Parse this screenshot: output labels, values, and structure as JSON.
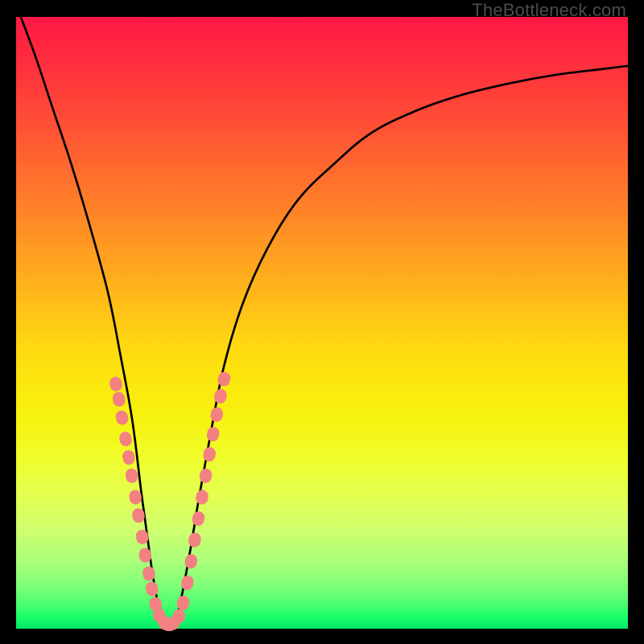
{
  "watermark": "TheBottleneck.com",
  "chart_data": {
    "type": "line",
    "title": "",
    "xlabel": "",
    "ylabel": "",
    "xlim": [
      0,
      100
    ],
    "ylim": [
      0,
      100
    ],
    "series": [
      {
        "name": "bottleneck-curve",
        "x": [
          0,
          3,
          6,
          9,
          12,
          15,
          17,
          19,
          20.5,
          22,
          23,
          24,
          25,
          26,
          27,
          28.5,
          30,
          32,
          34,
          37,
          41,
          46,
          52,
          58,
          65,
          72,
          80,
          88,
          96,
          100
        ],
        "values": [
          102,
          94,
          85,
          76,
          66,
          55,
          45,
          34,
          22,
          11,
          5,
          1,
          0,
          1,
          5,
          13,
          22,
          33,
          43,
          53,
          62,
          70,
          76,
          81,
          84.5,
          87,
          89,
          90.5,
          91.5,
          92
        ]
      }
    ],
    "highlight_beads": {
      "comment": "salmon bead overlays near valley, in plot-percent coords",
      "left_arm": [
        [
          16.3,
          40
        ],
        [
          16.8,
          37.5
        ],
        [
          17.3,
          34.5
        ],
        [
          17.9,
          31
        ],
        [
          18.4,
          28
        ],
        [
          18.9,
          25
        ],
        [
          19.5,
          21.5
        ],
        [
          20.0,
          18.5
        ],
        [
          20.6,
          15
        ],
        [
          21.1,
          12
        ],
        [
          21.7,
          9
        ],
        [
          22.2,
          6.5
        ],
        [
          22.8,
          4
        ],
        [
          23.4,
          2.2
        ],
        [
          24.2,
          1.0
        ]
      ],
      "bottom": [
        [
          25.0,
          0.6
        ],
        [
          25.8,
          1.0
        ],
        [
          26.6,
          2.0
        ]
      ],
      "right_arm": [
        [
          27.3,
          4.2
        ],
        [
          28.0,
          7.5
        ],
        [
          28.6,
          11
        ],
        [
          29.2,
          14.5
        ],
        [
          29.8,
          18
        ],
        [
          30.4,
          21.5
        ],
        [
          31.0,
          25
        ],
        [
          31.6,
          28.5
        ],
        [
          32.2,
          31.8
        ],
        [
          32.8,
          35
        ],
        [
          33.4,
          38
        ],
        [
          34.0,
          40.8
        ]
      ]
    }
  }
}
